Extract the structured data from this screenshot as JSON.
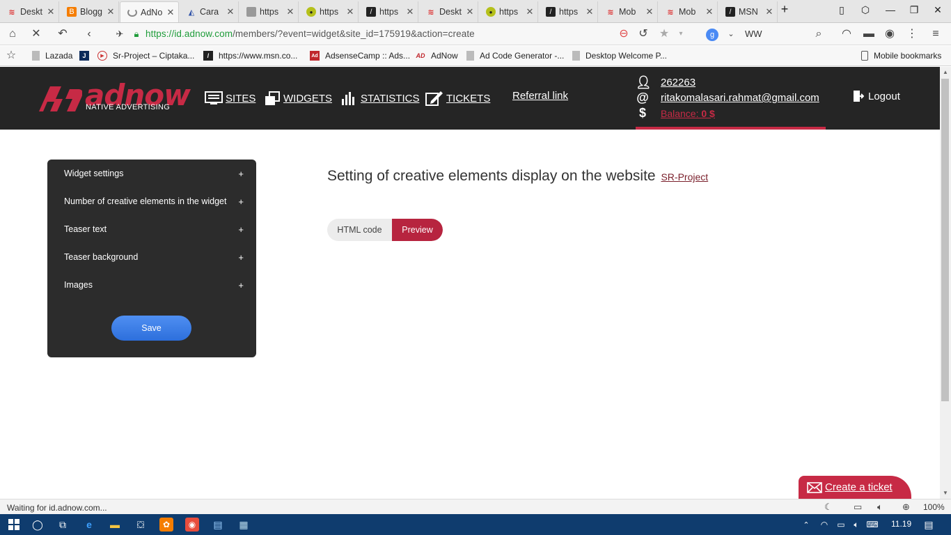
{
  "browser": {
    "tabs": [
      {
        "label": "Deskt",
        "icon": "wifi-icon"
      },
      {
        "label": "Blogg",
        "icon": "blogger-icon"
      },
      {
        "label": "AdNo",
        "icon": "loading-spinner-icon"
      },
      {
        "label": "Cara",
        "icon": "cara-icon"
      },
      {
        "label": "https",
        "icon": "document-icon"
      },
      {
        "label": "https",
        "icon": "owl-icon"
      },
      {
        "label": "https",
        "icon": "msn-icon"
      },
      {
        "label": "Deskt",
        "icon": "wifi-icon"
      },
      {
        "label": "https",
        "icon": "owl-icon"
      },
      {
        "label": "https",
        "icon": "msn-icon"
      },
      {
        "label": "Mob",
        "icon": "wifi-icon"
      },
      {
        "label": "Mob",
        "icon": "wifi-icon"
      },
      {
        "label": "MSN",
        "icon": "msn-icon"
      }
    ],
    "new_tab": "+",
    "url_host": "https://id.adnow.com",
    "url_path": "/members/?event=widget&site_id=175919&action=create",
    "search_value": "WW",
    "bookmarks": [
      {
        "label": "Lazada",
        "icon": "page-icon"
      },
      {
        "label": "J",
        "icon": "j-icon"
      },
      {
        "label": "Sr-Project – Ciptaka...",
        "icon": "play-icon"
      },
      {
        "label": "https://www.msn.co...",
        "icon": "msn-icon"
      },
      {
        "label": "AdsenseCamp :: Ads...",
        "icon": "adsensecamp-icon"
      },
      {
        "label": "AdNow",
        "icon": "adnow-icon"
      },
      {
        "label": "Ad Code Generator -...",
        "icon": "page-icon"
      },
      {
        "label": "Desktop Welcome P...",
        "icon": "page-icon"
      }
    ],
    "mobile_bookmarks": "Mobile bookmarks",
    "status_text": "Waiting for id.adnow.com...",
    "zoom": "100%"
  },
  "site": {
    "logo_word": "adnow",
    "logo_sub": "NATIVE ADVERTISING",
    "nav": {
      "sites": "SITES",
      "widgets": "WIDGETS",
      "statistics": "STATISTICS",
      "tickets": "TICKETS"
    },
    "referral": "Referral link",
    "user": {
      "id": "262263",
      "email": "ritakomalasari.rahmat@gmail.com",
      "balance_label": "Balance: ",
      "balance_value": "0 $"
    },
    "logout": "Logout",
    "accent_color": "#c72a45"
  },
  "panel": {
    "items": [
      {
        "label": "Widget settings",
        "toggle": "+"
      },
      {
        "label": "Number of creative elements in the widget",
        "toggle": "+"
      },
      {
        "label": "Teaser text",
        "toggle": "+"
      },
      {
        "label": "Teaser background",
        "toggle": "+"
      },
      {
        "label": "Images",
        "toggle": "+"
      }
    ],
    "save": "Save"
  },
  "main": {
    "title": "Setting of creative elements display on the website",
    "site_link": "SR-Project",
    "toggle_html": "HTML code",
    "toggle_preview": "Preview"
  },
  "ticket": {
    "label": "Create a ticket"
  },
  "taskbar": {
    "time": "11.19"
  }
}
